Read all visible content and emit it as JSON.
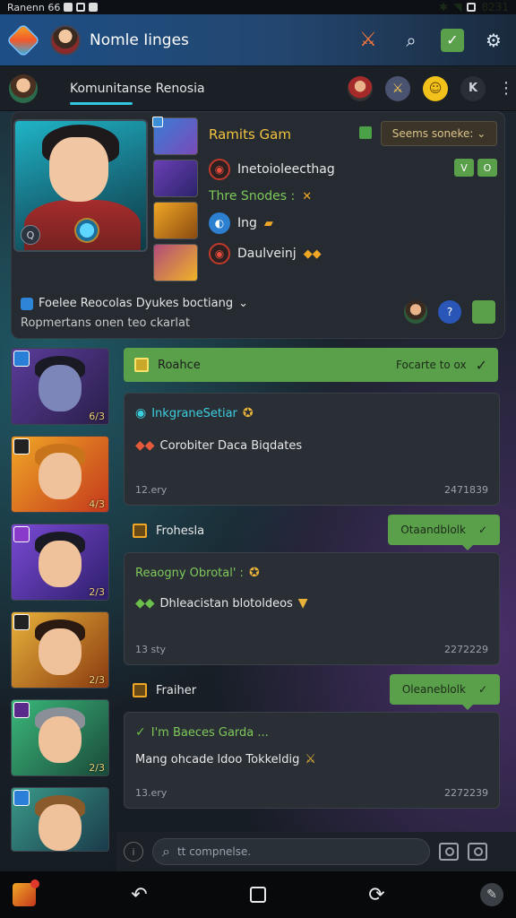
{
  "status_bar": {
    "carrier": "Ranenn 66",
    "clock": "8231"
  },
  "app_header": {
    "title": "Nomle Iinges",
    "icons": [
      "app-logo",
      "sword-icon",
      "search-icon",
      "check-icon",
      "gear-icon"
    ]
  },
  "sub_header": {
    "title": "Komunitanse Renosia",
    "icons": [
      "hero-avatar",
      "sword-icon",
      "smile-icon",
      "k-icon",
      "more-icon"
    ]
  },
  "profile": {
    "name": "Ramits Gam",
    "pill_label": "Seems soneke:",
    "pill_chevron": "⌄",
    "rows": [
      {
        "label": "Inetoioleecthag",
        "icon": "red-shield-icon"
      },
      {
        "label": "Thre Snodes :",
        "icon": ""
      },
      {
        "label": "Ing",
        "icon": "blue-orb-icon"
      },
      {
        "label": "Daulveinj",
        "icon": "red-shield-icon"
      }
    ],
    "toggles": [
      "V",
      "O"
    ],
    "badge": "Q",
    "footer_line1": "Foelee Reocolas Dyukes boctiang",
    "footer_chevron": "⌄",
    "footer_line2": "Ropmertans onen  teo  ckarlat"
  },
  "heroes": [
    {
      "level": "6/3"
    },
    {
      "level": "4/3"
    },
    {
      "level": "2/3"
    },
    {
      "level": "2/3"
    },
    {
      "level": "2/3"
    },
    {
      "level": ""
    }
  ],
  "feed": {
    "section_bar": {
      "label": "Roahce",
      "right": "Focarte to ox"
    },
    "posts": [
      {
        "line1": "InkgraneSetiar",
        "line2": "Corobiter   Daca Biqdates",
        "time": "12.ery",
        "date": "2471839"
      },
      {
        "line1": "Reaogny Obrotal' :",
        "line2": "Dhleacistan   blotoldeos",
        "time": "13 sty",
        "date": "2272229"
      },
      {
        "line1": "I'm Baeces Garda ...",
        "line2": "Mang ohcade ldoo   Tokkeldig",
        "time": "13.ery",
        "date": "2272239"
      }
    ],
    "replies": [
      {
        "label": "Frohesla",
        "bubble": "Otaandblolk"
      },
      {
        "label": "Fraiher",
        "bubble": "Oleaneblolk"
      }
    ]
  },
  "composer": {
    "placeholder": "tt compnelse."
  },
  "nav": {
    "items": [
      "back-icon",
      "home-icon",
      "recent-icon",
      "pen-icon"
    ]
  },
  "colors": {
    "accent_green": "#5aa04b",
    "accent_gold": "#f2c33e",
    "accent_cyan": "#34c8e0",
    "header_blue": "#1d4f86"
  }
}
